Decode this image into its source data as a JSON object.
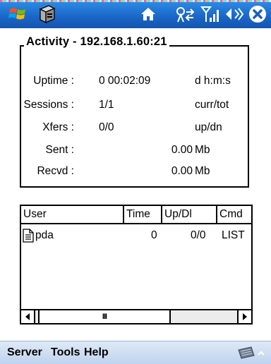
{
  "activity": {
    "title": "Activity - 192.168.1.60:21",
    "rows": [
      {
        "label": "Uptime :",
        "value": "0 00:02:09",
        "unit": "d h:m:s"
      },
      {
        "label": "Sessions :",
        "value": "1/1",
        "unit": "curr/tot"
      },
      {
        "label": "Xfers :",
        "value": "0/0",
        "unit": "up/dn"
      },
      {
        "label": "Sent :",
        "value": "0.00",
        "unit": "Mb"
      },
      {
        "label": "Recvd :",
        "value": "0.00",
        "unit": "Mb"
      }
    ]
  },
  "list": {
    "columns": [
      "User",
      "Time",
      "Up/Dl",
      "Cmd"
    ],
    "rows": [
      {
        "user": "pda",
        "time": "0",
        "updl": "0/0",
        "cmd": "LIST"
      }
    ],
    "scrollbar_thumb_glyph": "III"
  },
  "menu": {
    "items": [
      "Server",
      "Tools",
      "Help"
    ]
  },
  "icons": {
    "start": "windows-start-icon",
    "app": "app-icon",
    "home": "home-icon",
    "connectivity": "connectivity-icon",
    "signal": "signal-icon",
    "volume": "volume-icon",
    "close": "close-icon",
    "keyboard": "keyboard-icon"
  },
  "colors": {
    "titlebar": "#1a66c7",
    "menubar": "#c9dbf0",
    "text": "#000000"
  }
}
